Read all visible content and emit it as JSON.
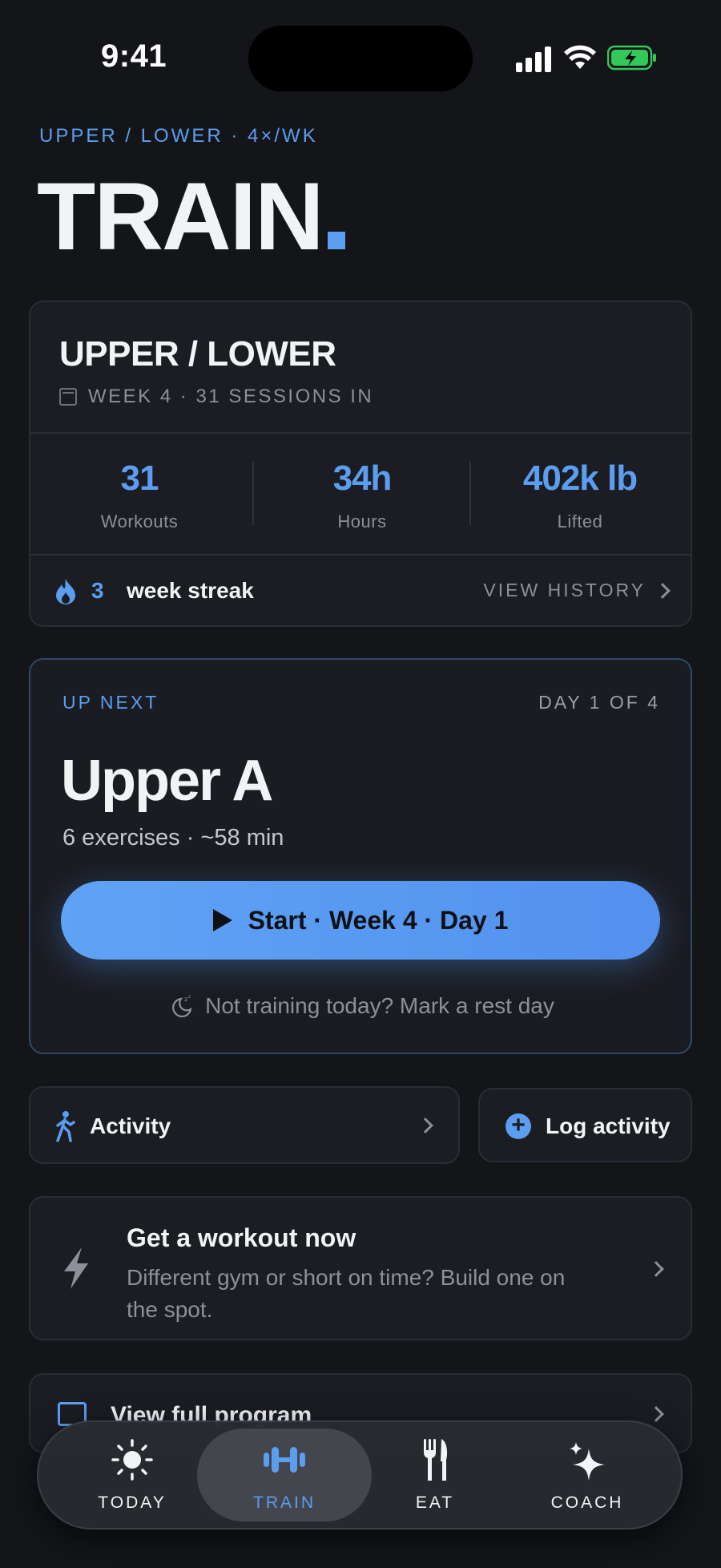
{
  "status": {
    "time": "9:41"
  },
  "header": {
    "eyebrow": "UPPER / LOWER · 4×/WK",
    "title": "TRAIN"
  },
  "program": {
    "name": "UPPER / LOWER",
    "meta": "WEEK 4 · 31 SESSIONS IN",
    "stats": [
      {
        "value": "31",
        "label": "Workouts"
      },
      {
        "value": "34h",
        "label": "Hours"
      },
      {
        "value": "402k lb",
        "label": "Lifted"
      }
    ],
    "streak_count": "3",
    "streak_label": "week streak",
    "history_label": "VIEW HISTORY"
  },
  "up_next": {
    "eyebrow": "UP NEXT",
    "day_of": "DAY 1 OF 4",
    "name": "Upper A",
    "meta": "6 exercises · ~58 min",
    "start_label": "Start · Week 4 · Day 1",
    "rest_label": "Not training today? Mark a rest day"
  },
  "quick": {
    "activity_label": "Activity",
    "log_label": "Log activity"
  },
  "generate": {
    "title": "Get a workout now",
    "description": "Different gym or short on time? Build one on the spot."
  },
  "full_program": {
    "label": "View full program"
  },
  "tabs": [
    {
      "label": "TODAY",
      "icon": "sun-icon"
    },
    {
      "label": "TRAIN",
      "icon": "dumbbell-icon",
      "active": true
    },
    {
      "label": "EAT",
      "icon": "fork-knife-icon"
    },
    {
      "label": "COACH",
      "icon": "sparkle-icon"
    }
  ],
  "colors": {
    "accent": "#5B9EF0",
    "background": "#131519",
    "card": "#1B1D23",
    "battery": "#34C759"
  }
}
